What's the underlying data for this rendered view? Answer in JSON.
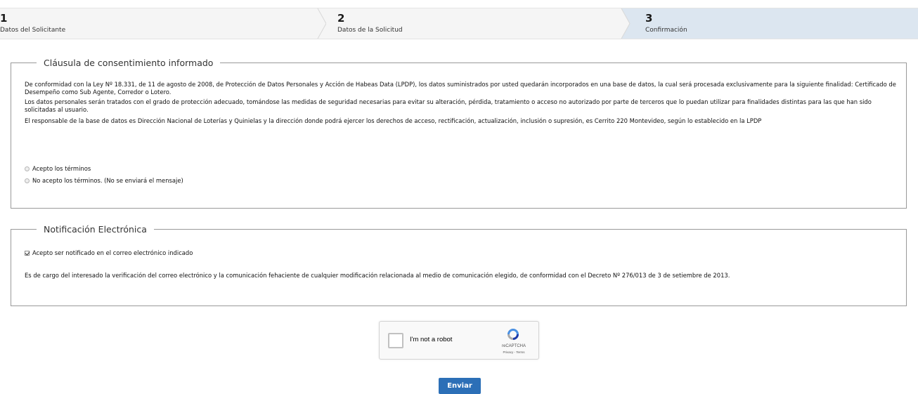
{
  "wizard": {
    "steps": [
      {
        "number": "1",
        "label": "Datos del Solicitante"
      },
      {
        "number": "2",
        "label": "Datos de la Solicitud"
      },
      {
        "number": "3",
        "label": "Confirmación"
      }
    ],
    "active_step": 3
  },
  "consent": {
    "legend": "Cláusula de consentimiento informado",
    "paragraphs": [
      "De conformidad con la Ley Nº 18.331, de 11 de agosto de 2008, de Protección de Datos Personales y Acción de Habeas Data (LPDP), los datos suministrados por usted quedarán incorporados en una base de datos, la cual será procesada exclusivamente para la siguiente finalidad: Certificado de Desempeño como Sub Agente, Corredor o Lotero.",
      "Los datos personales serán tratados con el grado de protección adecuado, tomándose las medidas de seguridad necesarias para evitar su alteración, pérdida, tratamiento o acceso no autorizado por parte de terceros que lo puedan utilizar para finalidades distintas para las que han sido solicitadas al usuario.",
      "El responsable de la base de datos es Dirección Nacional de Loterías y Quinielas y la dirección donde podrá ejercer los derechos de acceso, rectificación, actualización, inclusión o supresión, es Cerrito 220 Montevideo, según lo establecido en la LPDP"
    ],
    "options": [
      "Acepto los términos",
      "No acepto los términos. (No se enviará el mensaje)"
    ]
  },
  "notification": {
    "legend": "Notificación Electrónica",
    "checkbox_label": "Acepto ser notificado en el correo electrónico indicado",
    "checkbox_checked": true,
    "note": "Es de cargo del interesado la verificación del correo electrónico y la comunicación fehaciente de cualquier modificación relacionada al medio de comunicación elegido, de conformidad con el Decreto Nº 276/013 de 3 de setiembre de 2013."
  },
  "recaptcha": {
    "label": "I'm not a robot",
    "brand": "reCAPTCHA",
    "links": "Privacy - Terms"
  },
  "submit": {
    "label": "Enviar"
  },
  "colors": {
    "active_step_bg": "#dce6f0",
    "button_bg": "#2c6fb7"
  }
}
